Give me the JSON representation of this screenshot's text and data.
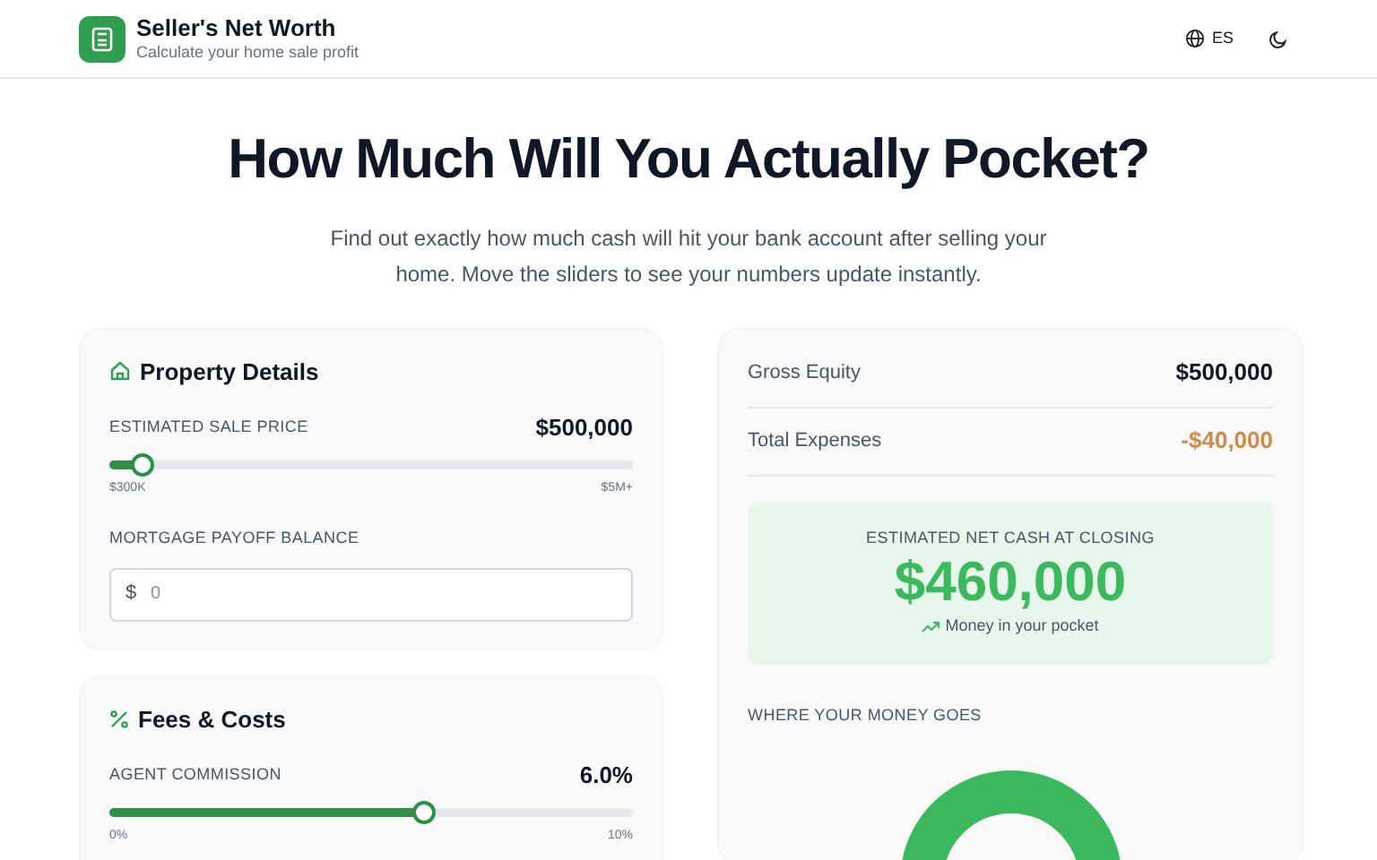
{
  "header": {
    "title": "Seller's Net Worth",
    "subtitle": "Calculate your home sale profit",
    "language": "ES"
  },
  "hero": {
    "title": "How Much Will You Actually Pocket?",
    "text": "Find out exactly how much cash will hit your bank account after selling your home. Move the sliders to see your numbers update instantly."
  },
  "property": {
    "title": "Property Details",
    "sale_price": {
      "label": "ESTIMATED SALE PRICE",
      "value": "$500,000",
      "level": 0.06,
      "min": "$300K",
      "max": "$5M+"
    },
    "mortgage": {
      "label": "MORTGAGE PAYOFF BALANCE",
      "prefix": "$",
      "placeholder": "0"
    }
  },
  "fees": {
    "title": "Fees & Costs",
    "commission": {
      "label": "AGENT COMMISSION",
      "value": "6.0%",
      "level": 0.6,
      "min": "0%",
      "max": "10%"
    }
  },
  "summary": {
    "rows": [
      {
        "label": "Gross Equity",
        "value": "$500,000",
        "kind": "plain"
      },
      {
        "label": "Total Expenses",
        "value": "-$40,000",
        "kind": "expense"
      }
    ],
    "net": {
      "label": "ESTIMATED NET CASH AT CLOSING",
      "value": "$460,000",
      "note": "Money in your pocket"
    },
    "breakdown_title": "WHERE YOUR MONEY GOES"
  }
}
